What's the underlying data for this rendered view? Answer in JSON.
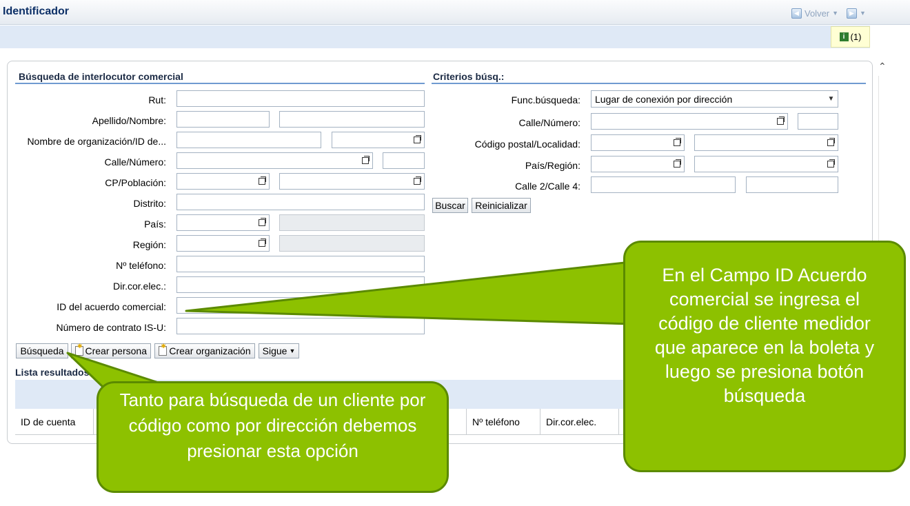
{
  "header": {
    "title": "Identificador",
    "back_label": "Volver",
    "messages_count": "(1)"
  },
  "search_section": {
    "title": "Búsqueda de interlocutor comercial",
    "labels": {
      "rut": "Rut:",
      "name": "Apellido/Nombre:",
      "org": "Nombre de organización/ID de...",
      "street": "Calle/Número:",
      "postal": "CP/Población:",
      "district": "Distrito:",
      "country": "País:",
      "region": "Región:",
      "phone": "Nº teléfono:",
      "email": "Dir.cor.elec.:",
      "agreement_id": "ID del acuerdo comercial:",
      "contract": "Número de contrato IS-U:"
    },
    "buttons": {
      "search": "Búsqueda",
      "create_person": "Crear persona",
      "create_org": "Crear organización",
      "more": "Sigue"
    }
  },
  "criteria_section": {
    "title": "Criterios búsq.:",
    "labels": {
      "func": "Func.búsqueda:",
      "street": "Calle/Número:",
      "postal": "Código postal/Localidad:",
      "country": "País/Región:",
      "street2": "Calle 2/Calle 4:"
    },
    "func_value": "Lugar de conexión por dirección",
    "buttons": {
      "search": "Buscar",
      "reset": "Reinicializar"
    }
  },
  "results": {
    "title": "Lista resultados",
    "columns": [
      "ID de cuenta",
      "Nº teléfono",
      "Dir.cor.elec."
    ]
  },
  "callouts": {
    "right": "En el Campo ID Acuerdo comercial se ingresa el código de cliente medidor que aparece en la boleta y luego se presiona botón búsqueda",
    "bottom": "Tanto para búsqueda de un cliente por código como por dirección debemos presionar esta opción"
  },
  "colors": {
    "callout_fill": "#8dc100",
    "callout_border": "#5b8a00",
    "section_line": "#6f9ad0"
  }
}
